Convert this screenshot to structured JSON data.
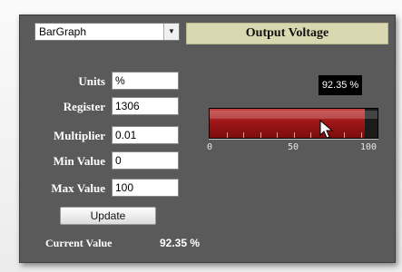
{
  "widget_type": "BarGraph",
  "title": "Output Voltage",
  "fields": [
    {
      "label": "Units",
      "value": "%"
    },
    {
      "label": "Register",
      "value": "1306"
    },
    {
      "label": "Multiplier",
      "value": "0.01"
    },
    {
      "label": "Min Value",
      "value": "0"
    },
    {
      "label": "Max Value",
      "value": "100"
    }
  ],
  "update_label": "Update",
  "current_label": "Current Value",
  "current_value": "92.35 %",
  "bar": {
    "readout": "92.35 %",
    "value": 92.35,
    "min": 0,
    "max": 100,
    "tick_labels": [
      "0",
      "50",
      "100"
    ],
    "fill_color": "#9e1616"
  }
}
